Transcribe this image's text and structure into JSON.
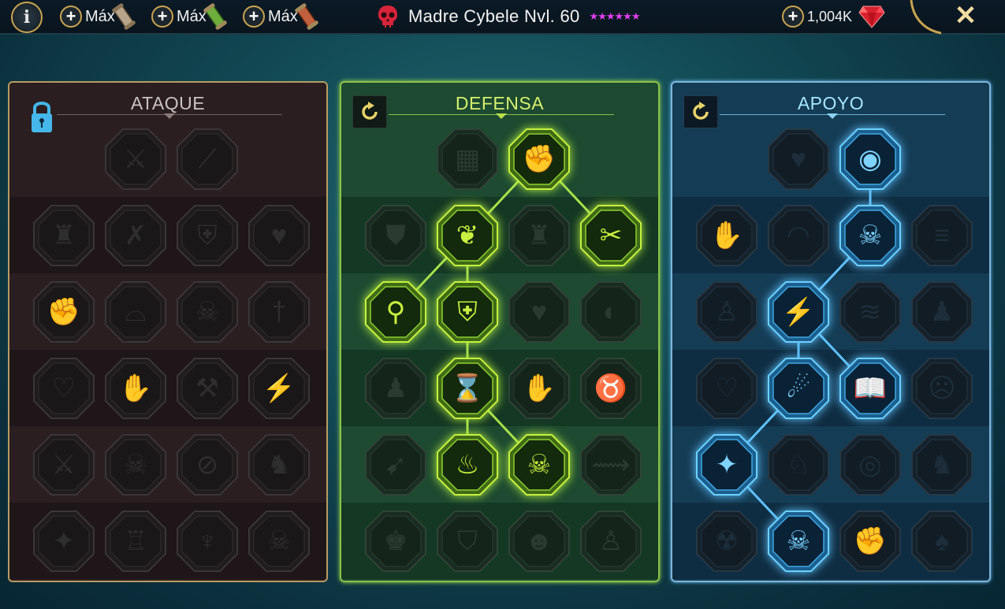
{
  "topbar": {
    "info_label": "i",
    "resources": [
      {
        "plus": "+",
        "label": "Máx",
        "icon": "scroll-brown-icon",
        "color": "#b7a48a"
      },
      {
        "plus": "+",
        "label": "Máx",
        "icon": "scroll-green-icon",
        "color": "#6fae3c"
      },
      {
        "plus": "+",
        "label": "Máx",
        "icon": "scroll-red-icon",
        "color": "#c0603c"
      }
    ],
    "title": "Madre Cybele Nvl. 60",
    "stars": "★★★★★★",
    "gems": {
      "plus": "+",
      "value": "1,004K",
      "icon": "ruby-gem-icon"
    },
    "close_label": "✕"
  },
  "colors": {
    "gold": "#c9a450",
    "defense_active": "#a5e04a",
    "support_active": "#5fc2ff",
    "skull_red": "#d8243a",
    "stars": "#e040f0"
  },
  "panels": {
    "ataque": {
      "title": "ATAQUE",
      "state": "locked",
      "icon": "padlock-icon"
    },
    "defensa": {
      "title": "DEFENSA",
      "state": "active",
      "icon": "reset-icon"
    },
    "apoyo": {
      "title": "APOYO",
      "state": "active",
      "icon": "reset-icon"
    }
  },
  "nodes": {
    "ataque": [
      {
        "row": 0,
        "col": 1,
        "icon": "crossed-swords-icon",
        "glyph": "⚔",
        "active": false
      },
      {
        "row": 0,
        "col": 2,
        "icon": "claw-slash-icon",
        "glyph": "⟋",
        "active": false
      },
      {
        "row": 1,
        "col": 0,
        "icon": "horned-warrior-icon",
        "glyph": "♜",
        "active": false
      },
      {
        "row": 1,
        "col": 1,
        "icon": "slash-arrows-icon",
        "glyph": "✗",
        "active": false
      },
      {
        "row": 1,
        "col": 2,
        "icon": "shield-break-icon",
        "glyph": "⛨",
        "active": false
      },
      {
        "row": 1,
        "col": 3,
        "icon": "bleeding-heart-icon",
        "glyph": "♥",
        "active": false
      },
      {
        "row": 2,
        "col": 0,
        "icon": "rending-strike-icon",
        "glyph": "✊",
        "active": false
      },
      {
        "row": 2,
        "col": 1,
        "icon": "fangs-icon",
        "glyph": "⌓",
        "active": false
      },
      {
        "row": 2,
        "col": 2,
        "icon": "skull-swirl-icon",
        "glyph": "☠",
        "active": false
      },
      {
        "row": 2,
        "col": 3,
        "icon": "dagger-hand-icon",
        "glyph": "†",
        "active": false
      },
      {
        "row": 3,
        "col": 0,
        "icon": "heart-blade-icon",
        "glyph": "♡",
        "active": false
      },
      {
        "row": 3,
        "col": 1,
        "icon": "fist-blade-icon",
        "glyph": "✋",
        "active": false
      },
      {
        "row": 3,
        "col": 2,
        "icon": "axe-icon",
        "glyph": "⚒",
        "active": false
      },
      {
        "row": 3,
        "col": 3,
        "icon": "chain-lightning-icon",
        "glyph": "⚡",
        "active": false
      },
      {
        "row": 4,
        "col": 0,
        "icon": "triple-swords-icon",
        "glyph": "⚔",
        "active": false
      },
      {
        "row": 4,
        "col": 1,
        "icon": "twin-skulls-icon",
        "glyph": "☠",
        "active": false
      },
      {
        "row": 4,
        "col": 2,
        "icon": "spear-circle-icon",
        "glyph": "⊘",
        "active": false
      },
      {
        "row": 4,
        "col": 3,
        "icon": "flexing-figure-icon",
        "glyph": "♞",
        "active": false
      },
      {
        "row": 5,
        "col": 0,
        "icon": "sparkle-sword-icon",
        "glyph": "✦",
        "active": false
      },
      {
        "row": 5,
        "col": 1,
        "icon": "knight-helm-icon",
        "glyph": "♖",
        "active": false
      },
      {
        "row": 5,
        "col": 2,
        "icon": "demon-face-icon",
        "glyph": "♆",
        "active": false
      },
      {
        "row": 5,
        "col": 3,
        "icon": "flaming-skull-icon",
        "glyph": "☠",
        "active": false
      }
    ],
    "defensa": [
      {
        "row": 0,
        "col": 1,
        "icon": "tiles-icon",
        "glyph": "▦",
        "active": false
      },
      {
        "row": 0,
        "col": 2,
        "icon": "raised-fist-icon",
        "glyph": "✊",
        "active": true
      },
      {
        "row": 1,
        "col": 0,
        "icon": "chest-armor-icon",
        "glyph": "⛊",
        "active": false
      },
      {
        "row": 1,
        "col": 1,
        "icon": "heart-organ-icon",
        "glyph": "❦",
        "active": true
      },
      {
        "row": 1,
        "col": 2,
        "icon": "warrior-bust-icon",
        "glyph": "♜",
        "active": false
      },
      {
        "row": 1,
        "col": 3,
        "icon": "broken-blades-icon",
        "glyph": "✂",
        "active": true
      },
      {
        "row": 2,
        "col": 0,
        "icon": "parrying-figure-icon",
        "glyph": "⚲",
        "active": true
      },
      {
        "row": 2,
        "col": 1,
        "icon": "knight-shield-icon",
        "glyph": "⛨",
        "active": true
      },
      {
        "row": 2,
        "col": 2,
        "icon": "heart-skull-icon",
        "glyph": "♥",
        "active": false
      },
      {
        "row": 2,
        "col": 3,
        "icon": "hooded-head-icon",
        "glyph": "◐",
        "active": false
      },
      {
        "row": 3,
        "col": 0,
        "icon": "crowd-icon",
        "glyph": "♟",
        "active": false
      },
      {
        "row": 3,
        "col": 1,
        "icon": "hourglass-icon",
        "glyph": "⌛",
        "active": true
      },
      {
        "row": 3,
        "col": 2,
        "icon": "open-hand-icon",
        "glyph": "✋",
        "active": false
      },
      {
        "row": 3,
        "col": 3,
        "icon": "bull-head-icon",
        "glyph": "♉",
        "active": false
      },
      {
        "row": 4,
        "col": 0,
        "icon": "dashing-figure-icon",
        "glyph": "➹",
        "active": false
      },
      {
        "row": 4,
        "col": 1,
        "icon": "triple-flames-icon",
        "glyph": "♨",
        "active": true
      },
      {
        "row": 4,
        "col": 2,
        "icon": "radiant-skull-icon",
        "glyph": "☠",
        "active": true
      },
      {
        "row": 4,
        "col": 3,
        "icon": "swift-claw-icon",
        "glyph": "⟿",
        "active": false
      },
      {
        "row": 5,
        "col": 0,
        "icon": "armored-bust-icon",
        "glyph": "♚",
        "active": false
      },
      {
        "row": 5,
        "col": 1,
        "icon": "guard-shield-icon",
        "glyph": "⛉",
        "active": false
      },
      {
        "row": 5,
        "col": 2,
        "icon": "bearded-head-icon",
        "glyph": "☻",
        "active": false
      },
      {
        "row": 5,
        "col": 3,
        "icon": "strong-figure-icon",
        "glyph": "♙",
        "active": false
      }
    ],
    "apoyo": [
      {
        "row": 0,
        "col": 1,
        "icon": "heart-sparkles-icon",
        "glyph": "♥",
        "active": false
      },
      {
        "row": 0,
        "col": 2,
        "icon": "swirl-eye-icon",
        "glyph": "◉",
        "active": true
      },
      {
        "row": 1,
        "col": 0,
        "icon": "praying-hands-icon",
        "glyph": "✋",
        "active": false
      },
      {
        "row": 1,
        "col": 1,
        "icon": "arched-shield-icon",
        "glyph": "◠",
        "active": false
      },
      {
        "row": 1,
        "col": 2,
        "icon": "flaming-skull-icon",
        "glyph": "☠",
        "active": true
      },
      {
        "row": 1,
        "col": 3,
        "icon": "speed-blade-icon",
        "glyph": "≡",
        "active": false
      },
      {
        "row": 2,
        "col": 0,
        "icon": "empowered-figure-icon",
        "glyph": "♙",
        "active": false
      },
      {
        "row": 2,
        "col": 1,
        "icon": "lightning-shield-icon",
        "glyph": "⚡",
        "active": true
      },
      {
        "row": 2,
        "col": 2,
        "icon": "wind-gust-icon",
        "glyph": "≋",
        "active": false
      },
      {
        "row": 2,
        "col": 3,
        "icon": "standing-figure-icon",
        "glyph": "♟",
        "active": false
      },
      {
        "row": 3,
        "col": 0,
        "icon": "chained-heart-icon",
        "glyph": "♡",
        "active": false
      },
      {
        "row": 3,
        "col": 1,
        "icon": "comet-icon",
        "glyph": "☄",
        "active": true
      },
      {
        "row": 3,
        "col": 2,
        "icon": "open-book-icon",
        "glyph": "📖",
        "active": true
      },
      {
        "row": 3,
        "col": 3,
        "icon": "angry-face-icon",
        "glyph": "☹",
        "active": false
      },
      {
        "row": 4,
        "col": 0,
        "icon": "compass-star-icon",
        "glyph": "✦",
        "active": true
      },
      {
        "row": 4,
        "col": 1,
        "icon": "boot-speed-icon",
        "glyph": "♘",
        "active": false
      },
      {
        "row": 4,
        "col": 2,
        "icon": "eye-icon",
        "glyph": "◎",
        "active": false
      },
      {
        "row": 4,
        "col": 3,
        "icon": "leaping-figure-icon",
        "glyph": "♞",
        "active": false
      },
      {
        "row": 5,
        "col": 0,
        "icon": "potion-bomb-icon",
        "glyph": "☢",
        "active": false
      },
      {
        "row": 5,
        "col": 1,
        "icon": "lightning-skull-icon",
        "glyph": "☠",
        "active": true
      },
      {
        "row": 5,
        "col": 2,
        "icon": "gauntlet-icon",
        "glyph": "✊",
        "active": false
      },
      {
        "row": 5,
        "col": 3,
        "icon": "eagle-head-icon",
        "glyph": "♠",
        "active": false
      }
    ]
  },
  "links": {
    "defensa": [
      [
        [
          0,
          2
        ],
        [
          1,
          1
        ]
      ],
      [
        [
          0,
          2
        ],
        [
          1,
          3
        ]
      ],
      [
        [
          1,
          1
        ],
        [
          2,
          0
        ]
      ],
      [
        [
          1,
          1
        ],
        [
          2,
          1
        ]
      ],
      [
        [
          2,
          1
        ],
        [
          3,
          1
        ]
      ],
      [
        [
          3,
          1
        ],
        [
          4,
          1
        ]
      ],
      [
        [
          3,
          1
        ],
        [
          4,
          2
        ]
      ]
    ],
    "apoyo": [
      [
        [
          0,
          2
        ],
        [
          1,
          2
        ]
      ],
      [
        [
          1,
          2
        ],
        [
          2,
          1
        ]
      ],
      [
        [
          2,
          1
        ],
        [
          3,
          1
        ]
      ],
      [
        [
          2,
          1
        ],
        [
          3,
          2
        ]
      ],
      [
        [
          3,
          1
        ],
        [
          4,
          0
        ]
      ],
      [
        [
          4,
          0
        ],
        [
          5,
          1
        ]
      ]
    ]
  }
}
